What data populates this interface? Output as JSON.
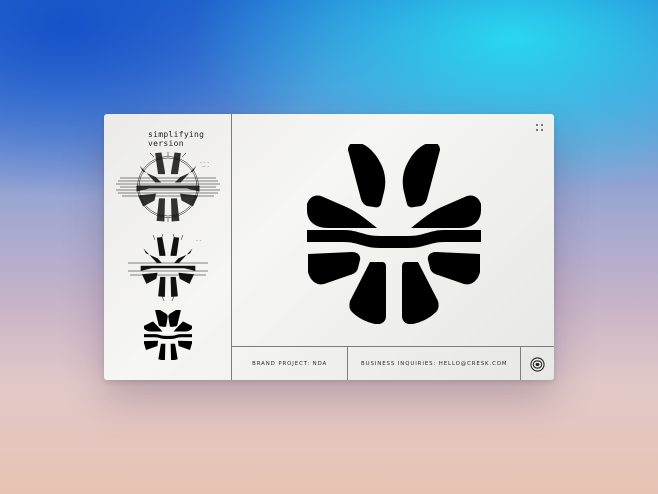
{
  "sidebar": {
    "note": "simplifying version"
  },
  "footer": {
    "brand_project": "BRAND PROJECT: NDA",
    "inquiries": "BUSINESS INQUIRIES: HELLO@CRESK.COM"
  },
  "icons": {
    "grip": "grip-icon",
    "studio": "studio-logo-icon",
    "main": "brand-mark-icon"
  },
  "colors": {
    "ink": "#000000",
    "card": "#efefed"
  }
}
